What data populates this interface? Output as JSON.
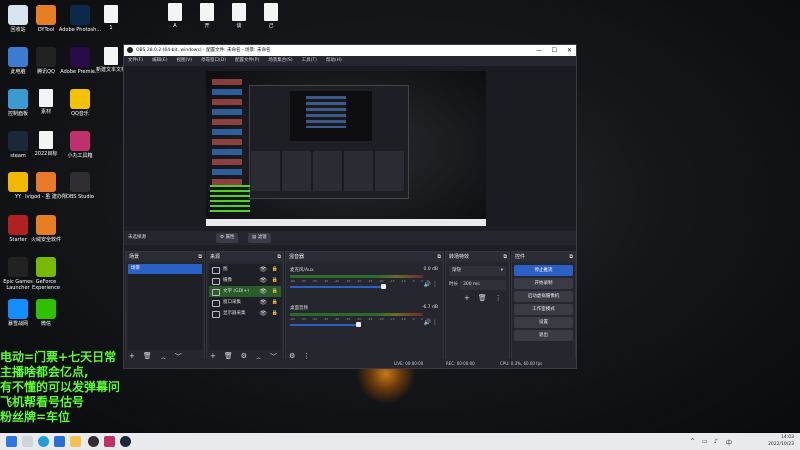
{
  "desktop": {
    "icons": [
      {
        "label": "回收站",
        "color": "#d9e3ee"
      },
      {
        "label": "DYTool",
        "color": "#e67e22"
      },
      {
        "label": "Adobe Photosh...",
        "color": "#0b2a4a"
      },
      {
        "label": "1",
        "color": "file"
      },
      {
        "label": "此电脑",
        "color": "#3b7bd1"
      },
      {
        "label": "腾讯QQ",
        "color": "#222"
      },
      {
        "label": "Adobe Premie...",
        "color": "#2a0b4a"
      },
      {
        "label": "新建文本文档",
        "color": "file"
      },
      {
        "label": "控制面板",
        "color": "#3b9bd1"
      },
      {
        "label": "素材",
        "color": "file"
      },
      {
        "label": "QQ音乐",
        "color": "#f2c300"
      },
      {
        "label": "steam",
        "color": "#1b2838"
      },
      {
        "label": "2022目标",
        "color": "file"
      },
      {
        "label": "小丸工具箱",
        "color": "#c0306a"
      },
      {
        "label": "YY",
        "color": "#f0b800"
      },
      {
        "label": "Ivigod - 虽 建办所",
        "color": "#e8782a"
      },
      {
        "label": "OBS Studio",
        "color": "#302e31"
      },
      {
        "label": "Starter",
        "color": "#b02222"
      },
      {
        "label": "火绒安全软件",
        "color": "#e67e22"
      },
      {
        "label": "Epic Games Launcher",
        "color": "#222"
      },
      {
        "label": "GeForce Experience",
        "color": "#76b900"
      },
      {
        "label": "暴雪战网",
        "color": "#148eff"
      },
      {
        "label": "微信",
        "color": "#2dc100"
      }
    ],
    "top_files": [
      "A",
      "开",
      "谈",
      "己"
    ],
    "overlay_lines": [
      "电动=门票+七天日常",
      "主播啥都会亿点,",
      "有不懂的可以发弹幕问",
      "飞机帮看号估号",
      "粉丝牌=车位"
    ]
  },
  "obs": {
    "title": "OBS 28.0.2 (64-bit, windows) - 配置文件: 未命名 - 场景: 未命名",
    "menu": [
      "文件(F)",
      "编辑(E)",
      "视图(V)",
      "停靠窗口(D)",
      "配置文件(P)",
      "场景集合(S)",
      "工具(T)",
      "帮助(H)"
    ],
    "no_source": "未选择源",
    "properties": "属性",
    "filters": "滤镜",
    "scenes": {
      "title": "场景",
      "items": [
        "场景"
      ]
    },
    "sources": {
      "title": "来源",
      "items": [
        {
          "name": "图",
          "sel": false
        },
        {
          "name": "摄像",
          "sel": false
        },
        {
          "name": "文字 (GDI+)",
          "sel": true
        },
        {
          "name": "窗口采集",
          "sel": false
        },
        {
          "name": "显示器采集",
          "sel": false
        }
      ]
    },
    "mixer": {
      "title": "混音器",
      "channels": [
        {
          "name": "麦克风/Aux",
          "db": "0.0 dB",
          "level": 0.85
        },
        {
          "name": "桌面音频",
          "db": "-6.7 dB",
          "level": 0.62
        }
      ],
      "scale": [
        "-60",
        "-55",
        "-50",
        "-45",
        "-40",
        "-35",
        "-30",
        "-25",
        "-20",
        "-15",
        "-10",
        "-5",
        "0"
      ]
    },
    "transitions": {
      "title": "转场特效",
      "type": "渐隐",
      "duration_label": "时长",
      "duration": "300 ms"
    },
    "controls": {
      "title": "控件",
      "buttons": [
        "停止推流",
        "开始录制",
        "启动虚拟摄像机",
        "工作室模式",
        "设置",
        "退出"
      ]
    },
    "status": {
      "live": "LIVE: 00:00:00",
      "rec": "REC: 00:00:00",
      "cpu": "CPU: 0.3%, 60.00 fps"
    }
  },
  "taskbar": {
    "time": "14:03",
    "date": "2022/10/23"
  }
}
